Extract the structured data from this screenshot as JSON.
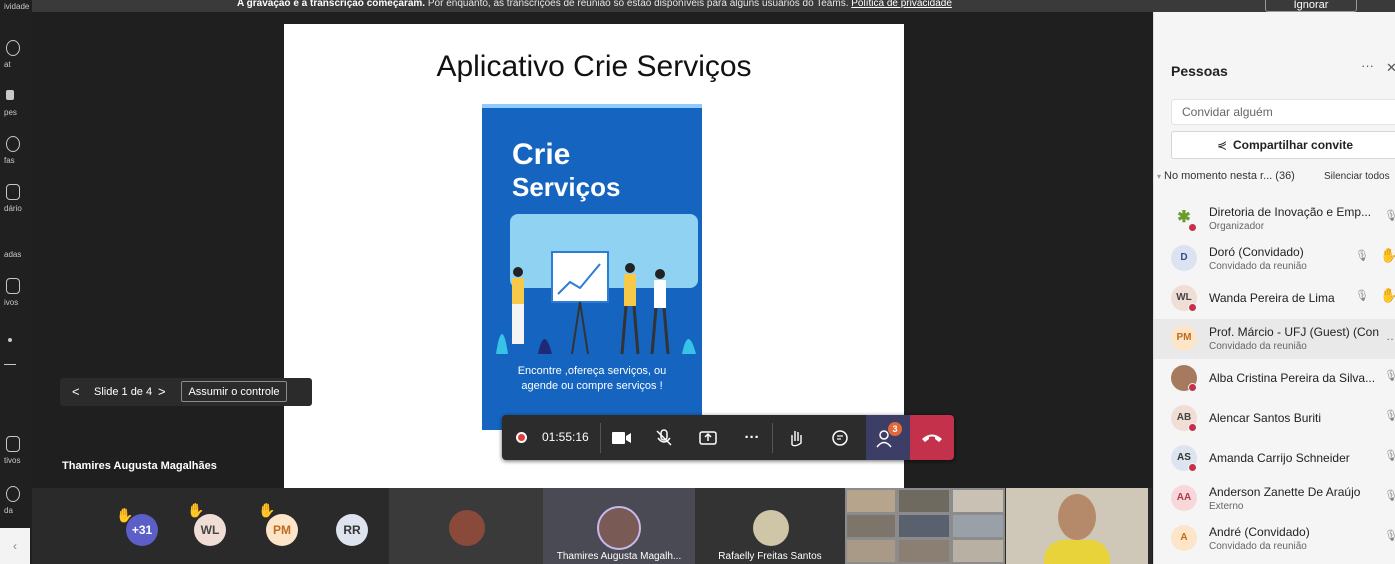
{
  "rail": {
    "items": [
      {
        "label": "ividade"
      },
      {
        "label": "at"
      },
      {
        "label": "pes"
      },
      {
        "label": "fas"
      },
      {
        "label": "dário"
      },
      {
        "label": "adas"
      },
      {
        "label": "ivos"
      },
      {
        "label": "tivos"
      },
      {
        "label": "da"
      }
    ]
  },
  "banner": {
    "lead": "A gravação e a transcrição começaram.",
    "text": " Por enquanto, as transcrições de reunião só estão disponíveis para alguns usuários do Teams.",
    "link": "Política de privacidade",
    "ignore": "Ignorar"
  },
  "slide": {
    "title": "Aplicativo Crie Serviços",
    "cover_line1": "Crie",
    "cover_line2": "Serviços",
    "cover_footer1": "Encontre ,ofereça serviços, ou",
    "cover_footer2": "agende ou compre serviços !"
  },
  "slide_nav": {
    "prev": "<",
    "counter": "Slide 1 de 4",
    "next": ">",
    "take_control": "Assumir o controle"
  },
  "presenter_name": "Thamires Augusta Magalhães",
  "controls": {
    "timer": "01:55:16",
    "people_badge": "3",
    "recording_color": "#e23b3b",
    "hangup_color": "#c4314b",
    "accent": "#3d3e66"
  },
  "gallery": {
    "overflow": "+31",
    "avatars": [
      "WL",
      "PM",
      "RR"
    ],
    "tile_names": [
      "Thamires Augusta Magalh...",
      "Rafaelly Freitas Santos"
    ]
  },
  "people_panel": {
    "title": "Pessoas",
    "more": "···",
    "close": "✕",
    "invite_placeholder": "Convidar alguém",
    "share_label": "Compartilhar convite",
    "section": "No momento nesta r... (36)",
    "mute_all": "Silenciar todos",
    "people": [
      {
        "initials": "",
        "name": "Diretoria de Inovação e Emp...",
        "role": "Organizador"
      },
      {
        "initials": "D",
        "name": "Doró (Convidado)",
        "role": "Convidado da reunião"
      },
      {
        "initials": "WL",
        "name": "Wanda Pereira de Lima",
        "role": ""
      },
      {
        "initials": "PM",
        "name": "Prof. Márcio - UFJ (Guest) (Con...",
        "role": "Convidado da reunião"
      },
      {
        "initials": "",
        "name": "Alba Cristina Pereira da Silva...",
        "role": ""
      },
      {
        "initials": "AB",
        "name": "Alencar Santos Buriti",
        "role": ""
      },
      {
        "initials": "AS",
        "name": "Amanda Carrijo Schneider",
        "role": ""
      },
      {
        "initials": "AA",
        "name": "Anderson Zanette De Araújo",
        "role": "Externo"
      },
      {
        "initials": "A",
        "name": "André (Convidado)",
        "role": "Convidado da reunião"
      }
    ]
  }
}
